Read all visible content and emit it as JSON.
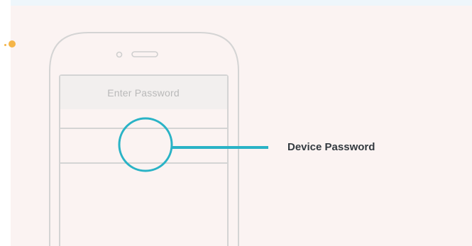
{
  "illustration": {
    "password_placeholder": "Enter Password",
    "callout_label": "Device Password"
  },
  "colors": {
    "background": "#fbf3f2",
    "top_strip": "#eef6fb",
    "phone_outline": "#d4d4d4",
    "field_fill": "#f2efee",
    "highlight": "#2ab3c6",
    "accent_dot": "#f5b548",
    "label_text": "#333a40"
  },
  "icons": {
    "camera": "front-camera-icon",
    "speaker": "earpiece-speaker-icon"
  }
}
